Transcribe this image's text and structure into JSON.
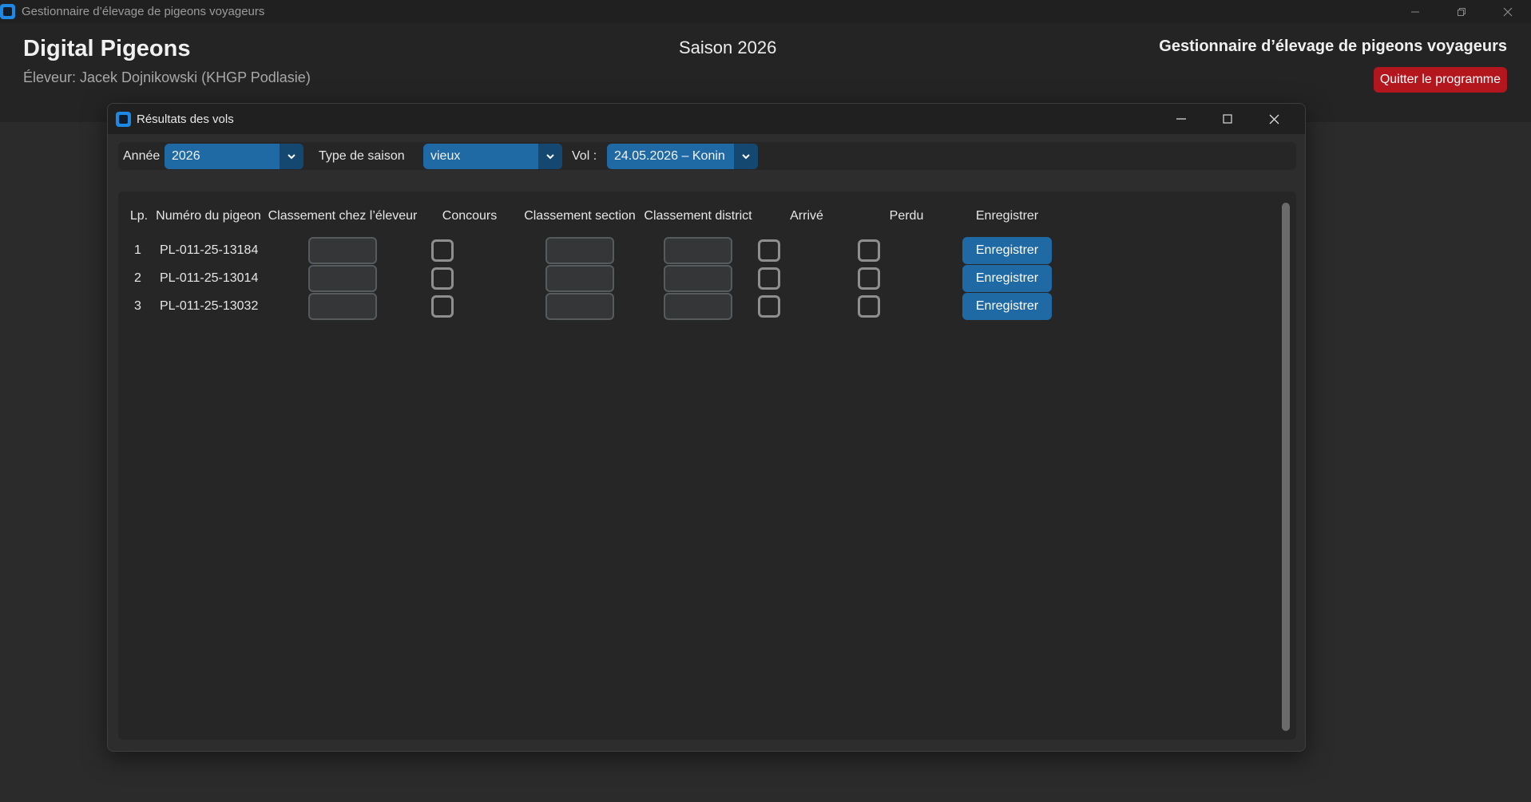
{
  "window": {
    "title": "Gestionnaire d’élevage de pigeons voyageurs"
  },
  "header": {
    "brand": "Digital Pigeons",
    "breeder": "Éleveur: Jacek Dojnikowski (KHGP Podlasie)",
    "season": "Saison 2026",
    "app_name": "Gestionnaire d’élevage de pigeons voyageurs",
    "quit_label": "Quitter le programme"
  },
  "dialog": {
    "title": "Résultats des vols",
    "filters": {
      "year_label": "Année",
      "year_value": "2026",
      "season_type_label": "Type de saison",
      "season_type_value": "vieux",
      "flight_label": "Vol :",
      "flight_value": "24.05.2026 – Konin"
    },
    "columns": {
      "lp": "Lp.",
      "pigeon_number": "Numéro du pigeon",
      "breeder_rank": "Classement chez l’éleveur",
      "contest": "Concours",
      "section_rank": "Classement section",
      "district_rank": "Classement district",
      "arrived": "Arrivé",
      "lost": "Perdu",
      "save": "Enregistrer"
    },
    "rows": [
      {
        "lp": "1",
        "pigeon": "PL-011-25-13184",
        "breeder_rank": "",
        "contest": false,
        "section_rank": "",
        "district_rank": "",
        "arrived": false,
        "lost": false,
        "save_label": "Enregistrer"
      },
      {
        "lp": "2",
        "pigeon": "PL-011-25-13014",
        "breeder_rank": "",
        "contest": false,
        "section_rank": "",
        "district_rank": "",
        "arrived": false,
        "lost": false,
        "save_label": "Enregistrer"
      },
      {
        "lp": "3",
        "pigeon": "PL-011-25-13032",
        "breeder_rank": "",
        "contest": false,
        "section_rank": "",
        "district_rank": "",
        "arrived": false,
        "lost": false,
        "save_label": "Enregistrer"
      }
    ]
  },
  "colors": {
    "accent": "#1f6aa5",
    "danger": "#b3161c",
    "background": "#2b2b2b"
  },
  "icons": [
    "app-icon",
    "minimize-icon",
    "restore-icon",
    "maximize-icon",
    "close-icon",
    "chevron-down-icon"
  ]
}
